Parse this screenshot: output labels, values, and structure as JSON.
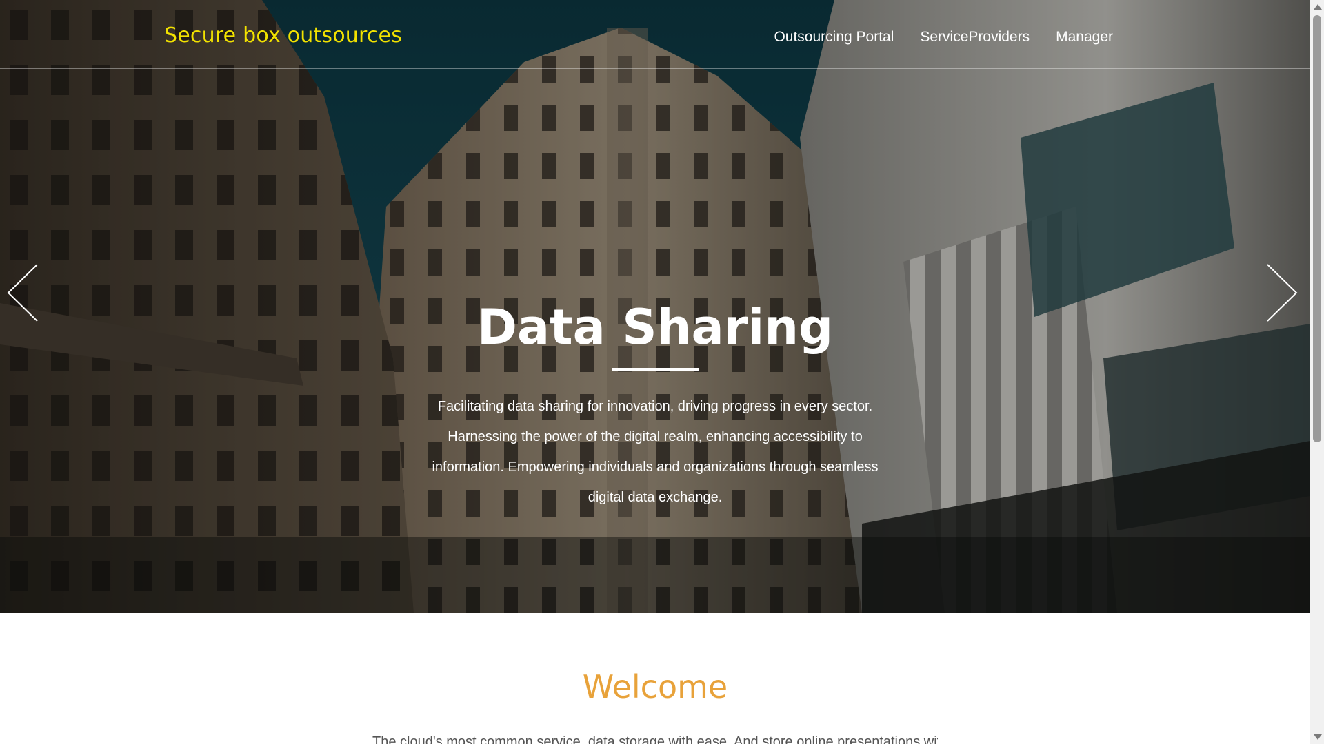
{
  "brand": {
    "name": "Secure box outsources",
    "color": "#f2e200"
  },
  "nav": {
    "items": [
      {
        "label": "Outsourcing Portal"
      },
      {
        "label": "ServiceProviders"
      },
      {
        "label": "Manager"
      }
    ]
  },
  "hero": {
    "title": "Data Sharing",
    "description": "Facilitating data sharing for innovation, driving progress in every sector. Harnessing the power of the digital realm, enhancing accessibility to information. Empowering individuals and organizations through seamless digital data exchange.",
    "prev_icon": "chevron-left-icon",
    "next_icon": "chevron-right-icon",
    "background": "city-buildings-photo"
  },
  "welcome": {
    "title": "Welcome",
    "text": "The cloud's most common service, data storage with ease. And store online presentations with practical..."
  },
  "colors": {
    "accent": "#e8a23a",
    "hero_text": "#ffffff"
  }
}
